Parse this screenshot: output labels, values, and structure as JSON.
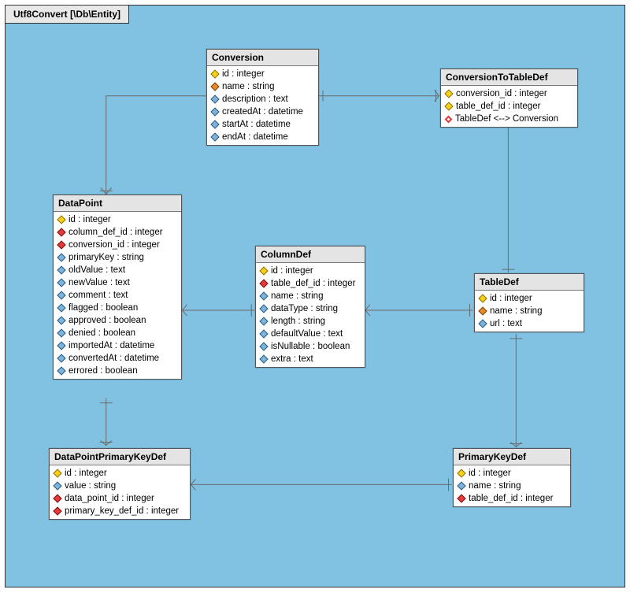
{
  "title": "Utf8Convert [\\Db\\Entity]",
  "chart_data": {
    "type": "diagram",
    "diagram_type": "ER",
    "namespace": "\\Db\\Entity",
    "entities": [
      {
        "name": "Conversion",
        "attributes": [
          {
            "icon": "pk",
            "name": "id",
            "type": "integer"
          },
          {
            "icon": "attr-orange",
            "name": "name",
            "type": "string"
          },
          {
            "icon": "attr",
            "name": "description",
            "type": "text"
          },
          {
            "icon": "attr",
            "name": "createdAt",
            "type": "datetime"
          },
          {
            "icon": "attr",
            "name": "startAt",
            "type": "datetime"
          },
          {
            "icon": "attr",
            "name": "endAt",
            "type": "datetime"
          }
        ]
      },
      {
        "name": "ConversionToTableDef",
        "attributes": [
          {
            "icon": "pk",
            "name": "conversion_id",
            "type": "integer"
          },
          {
            "icon": "pk",
            "name": "table_def_id",
            "type": "integer"
          },
          {
            "icon": "rel",
            "name": "TableDef <--> Conversion",
            "type": ""
          }
        ]
      },
      {
        "name": "DataPoint",
        "attributes": [
          {
            "icon": "pk",
            "name": "id",
            "type": "integer"
          },
          {
            "icon": "fk",
            "name": "column_def_id",
            "type": "integer"
          },
          {
            "icon": "fk",
            "name": "conversion_id",
            "type": "integer"
          },
          {
            "icon": "attr",
            "name": "primaryKey",
            "type": "string"
          },
          {
            "icon": "attr",
            "name": "oldValue",
            "type": "text"
          },
          {
            "icon": "attr",
            "name": "newValue",
            "type": "text"
          },
          {
            "icon": "attr",
            "name": "comment",
            "type": "text"
          },
          {
            "icon": "attr",
            "name": "flagged",
            "type": "boolean"
          },
          {
            "icon": "attr",
            "name": "approved",
            "type": "boolean"
          },
          {
            "icon": "attr",
            "name": "denied",
            "type": "boolean"
          },
          {
            "icon": "attr",
            "name": "importedAt",
            "type": "datetime"
          },
          {
            "icon": "attr",
            "name": "convertedAt",
            "type": "datetime"
          },
          {
            "icon": "attr",
            "name": "errored",
            "type": "boolean"
          }
        ]
      },
      {
        "name": "ColumnDef",
        "attributes": [
          {
            "icon": "pk",
            "name": "id",
            "type": "integer"
          },
          {
            "icon": "fk",
            "name": "table_def_id",
            "type": "integer"
          },
          {
            "icon": "attr",
            "name": "name",
            "type": "string"
          },
          {
            "icon": "attr",
            "name": "dataType",
            "type": "string"
          },
          {
            "icon": "attr",
            "name": "length",
            "type": "string"
          },
          {
            "icon": "attr",
            "name": "defaultValue",
            "type": "text"
          },
          {
            "icon": "attr",
            "name": "isNullable",
            "type": "boolean"
          },
          {
            "icon": "attr",
            "name": "extra",
            "type": "text"
          }
        ]
      },
      {
        "name": "TableDef",
        "attributes": [
          {
            "icon": "pk",
            "name": "id",
            "type": "integer"
          },
          {
            "icon": "attr-orange",
            "name": "name",
            "type": "string"
          },
          {
            "icon": "attr",
            "name": "url",
            "type": "text"
          }
        ]
      },
      {
        "name": "DataPointPrimaryKeyDef",
        "attributes": [
          {
            "icon": "pk",
            "name": "id",
            "type": "integer"
          },
          {
            "icon": "attr",
            "name": "value",
            "type": "string"
          },
          {
            "icon": "fk",
            "name": "data_point_id",
            "type": "integer"
          },
          {
            "icon": "fk",
            "name": "primary_key_def_id",
            "type": "integer"
          }
        ]
      },
      {
        "name": "PrimaryKeyDef",
        "attributes": [
          {
            "icon": "pk",
            "name": "id",
            "type": "integer"
          },
          {
            "icon": "attr",
            "name": "name",
            "type": "string"
          },
          {
            "icon": "fk",
            "name": "table_def_id",
            "type": "integer"
          }
        ]
      }
    ],
    "relationships": [
      {
        "from": "Conversion",
        "to": "DataPoint",
        "type": "one-to-many"
      },
      {
        "from": "Conversion",
        "to": "ConversionToTableDef",
        "type": "one-to-many"
      },
      {
        "from": "ConversionToTableDef",
        "to": "TableDef",
        "type": "many-to-one"
      },
      {
        "from": "DataPoint",
        "to": "ColumnDef",
        "type": "many-to-one"
      },
      {
        "from": "ColumnDef",
        "to": "TableDef",
        "type": "many-to-one"
      },
      {
        "from": "DataPoint",
        "to": "DataPointPrimaryKeyDef",
        "type": "one-to-many"
      },
      {
        "from": "DataPointPrimaryKeyDef",
        "to": "PrimaryKeyDef",
        "type": "many-to-one"
      },
      {
        "from": "TableDef",
        "to": "PrimaryKeyDef",
        "type": "one-to-many"
      }
    ]
  },
  "entities": {
    "conversion": {
      "title": "Conversion",
      "rows": [
        {
          "i": "pk",
          "t": "id : integer"
        },
        {
          "i": "ao",
          "t": "name : string"
        },
        {
          "i": "a",
          "t": "description : text"
        },
        {
          "i": "a",
          "t": "createdAt : datetime"
        },
        {
          "i": "a",
          "t": "startAt : datetime"
        },
        {
          "i": "a",
          "t": "endAt : datetime"
        }
      ]
    },
    "conversionToTableDef": {
      "title": "ConversionToTableDef",
      "rows": [
        {
          "i": "pk",
          "t": "conversion_id : integer"
        },
        {
          "i": "pk",
          "t": "table_def_id : integer"
        },
        {
          "i": "rel",
          "t": "TableDef <--> Conversion"
        }
      ]
    },
    "dataPoint": {
      "title": "DataPoint",
      "rows": [
        {
          "i": "pk",
          "t": "id : integer"
        },
        {
          "i": "fk",
          "t": "column_def_id : integer"
        },
        {
          "i": "fk",
          "t": "conversion_id : integer"
        },
        {
          "i": "a",
          "t": "primaryKey : string"
        },
        {
          "i": "a",
          "t": "oldValue : text"
        },
        {
          "i": "a",
          "t": "newValue : text"
        },
        {
          "i": "a",
          "t": "comment : text"
        },
        {
          "i": "a",
          "t": "flagged : boolean"
        },
        {
          "i": "a",
          "t": "approved : boolean"
        },
        {
          "i": "a",
          "t": "denied : boolean"
        },
        {
          "i": "a",
          "t": "importedAt : datetime"
        },
        {
          "i": "a",
          "t": "convertedAt : datetime"
        },
        {
          "i": "a",
          "t": "errored : boolean"
        }
      ]
    },
    "columnDef": {
      "title": "ColumnDef",
      "rows": [
        {
          "i": "pk",
          "t": "id : integer"
        },
        {
          "i": "fk",
          "t": "table_def_id : integer"
        },
        {
          "i": "a",
          "t": "name : string"
        },
        {
          "i": "a",
          "t": "dataType : string"
        },
        {
          "i": "a",
          "t": "length : string"
        },
        {
          "i": "a",
          "t": "defaultValue : text"
        },
        {
          "i": "a",
          "t": "isNullable : boolean"
        },
        {
          "i": "a",
          "t": "extra : text"
        }
      ]
    },
    "tableDef": {
      "title": "TableDef",
      "rows": [
        {
          "i": "pk",
          "t": "id : integer"
        },
        {
          "i": "ao",
          "t": "name : string"
        },
        {
          "i": "a",
          "t": "url : text"
        }
      ]
    },
    "dataPointPrimaryKeyDef": {
      "title": "DataPointPrimaryKeyDef",
      "rows": [
        {
          "i": "pk",
          "t": "id : integer"
        },
        {
          "i": "a",
          "t": "value : string"
        },
        {
          "i": "fk",
          "t": "data_point_id : integer"
        },
        {
          "i": "fk",
          "t": "primary_key_def_id : integer"
        }
      ]
    },
    "primaryKeyDef": {
      "title": "PrimaryKeyDef",
      "rows": [
        {
          "i": "pk",
          "t": "id : integer"
        },
        {
          "i": "a",
          "t": "name : string"
        },
        {
          "i": "fk",
          "t": "table_def_id : integer"
        }
      ]
    }
  }
}
